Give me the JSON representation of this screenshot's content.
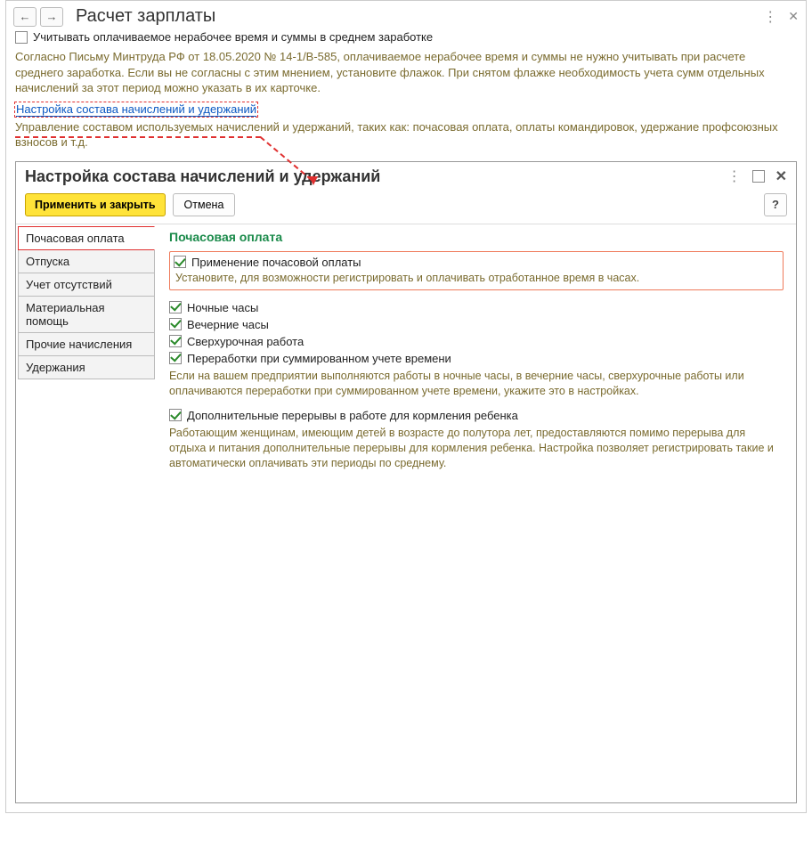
{
  "outer": {
    "title": "Расчет зарплаты",
    "checkbox_label": "Учитывать оплачиваемое нерабочее время и суммы в среднем заработке",
    "info_text": "Согласно Письму Минтруда РФ от 18.05.2020 № 14-1/В-585, оплачиваемое нерабочее время и суммы не нужно учитывать при расчете среднего заработка. Если вы не согласны с этим мнением, установите флажок. При снятом флажке необходимость учета сумм отдельных начислений за этот период можно указать в их карточке.",
    "link_label": "Настройка состава начислений и удержаний",
    "link_desc": "Управление составом используемых начислений и удержаний, таких как: почасовая оплата, оплаты командировок, удержание профсоюзных взносов и т.д."
  },
  "dialog": {
    "title": "Настройка состава начислений и удержаний",
    "apply_btn": "Применить и закрыть",
    "cancel_btn": "Отмена",
    "help_btn": "?",
    "tabs": [
      {
        "label": "Почасовая оплата",
        "active": true
      },
      {
        "label": "Отпуска"
      },
      {
        "label": "Учет отсутствий"
      },
      {
        "label": "Материальная помощь"
      },
      {
        "label": "Прочие начисления"
      },
      {
        "label": "Удержания"
      }
    ],
    "content": {
      "section_title": "Почасовая оплата",
      "highlight": {
        "label": "Применение почасовой оплаты",
        "desc": "Установите, для возможности регистрировать и оплачивать отработанное время в часах."
      },
      "opts": [
        {
          "label": "Ночные часы"
        },
        {
          "label": "Вечерние часы"
        },
        {
          "label": "Сверхурочная работа"
        },
        {
          "label": "Переработки при суммированном учете времени"
        }
      ],
      "opts_note": "Если на вашем предприятии выполняются работы в ночные часы, в вечерние часы, сверхурочные работы или оплачиваются переработки при суммированном учете времени, укажите это в настройках.",
      "opt2_label": "Дополнительные перерывы в работе для кормления ребенка",
      "opt2_note": "Работающим женщинам, имеющим детей в возрасте до полутора лет, предоставляются помимо перерыва для отдыха и питания дополнительные перерывы для кормления ребенка. Настройка позволяет регистрировать такие и автоматически оплачивать эти периоды по среднему."
    }
  }
}
